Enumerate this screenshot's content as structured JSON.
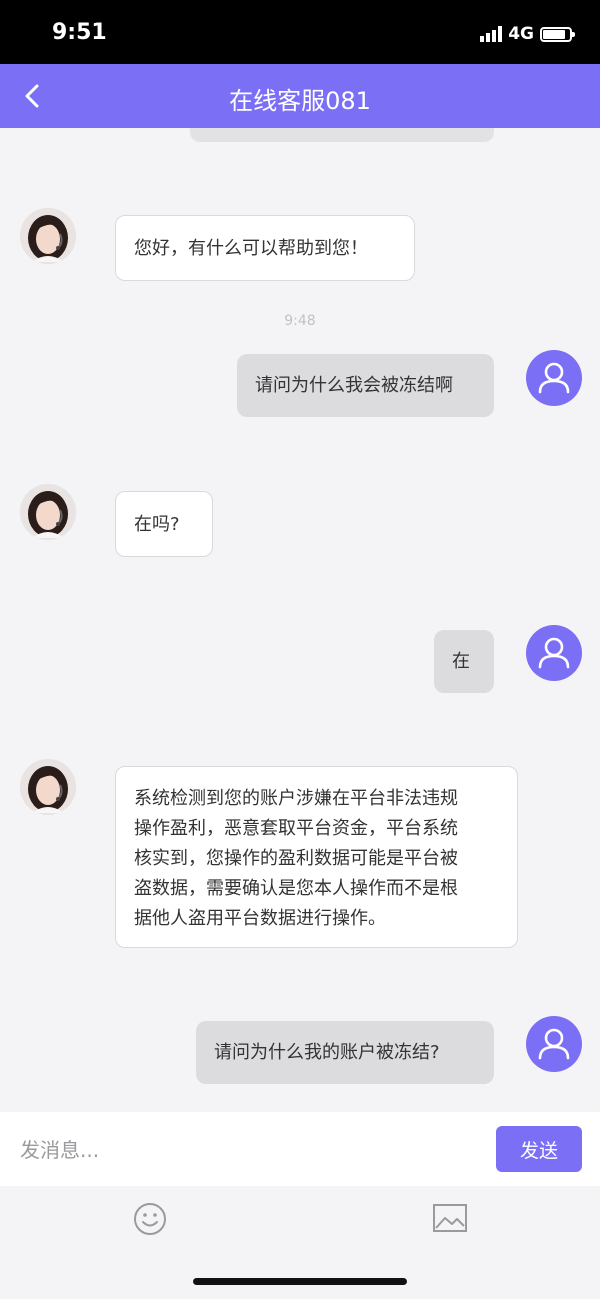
{
  "status_bar": {
    "time": "9:51",
    "network": "4G"
  },
  "header": {
    "title": "在线客服081"
  },
  "messages": [
    {
      "side": "agent",
      "text": "您好，有什么可以帮助到您！"
    },
    {
      "timestamp": "9:48"
    },
    {
      "side": "user",
      "text": "请问为什么我会被冻结啊"
    },
    {
      "side": "agent",
      "text": "在吗?"
    },
    {
      "side": "user",
      "text": "在"
    },
    {
      "side": "agent",
      "lines": [
        "系统检测到您的账户涉嫌在平台非法违规",
        "操作盈利，恶意套取平台资金，平台系统",
        "核实到，您操作的盈利数据可能是平台被",
        "盗数据，需要确认是您本人操作而不是根",
        "据他人盗用平台数据进行操作。"
      ]
    },
    {
      "side": "user",
      "text": "请问为什么我的账户被冻结?"
    }
  ],
  "composer": {
    "placeholder": "发消息...",
    "send_label": "发送"
  },
  "toolbar": {
    "emoji_icon": "smiley-icon",
    "image_icon": "image-icon"
  },
  "colors": {
    "accent": "#7b6ff6",
    "background": "#f4f4f6",
    "user_bubble": "#dcdcde"
  }
}
